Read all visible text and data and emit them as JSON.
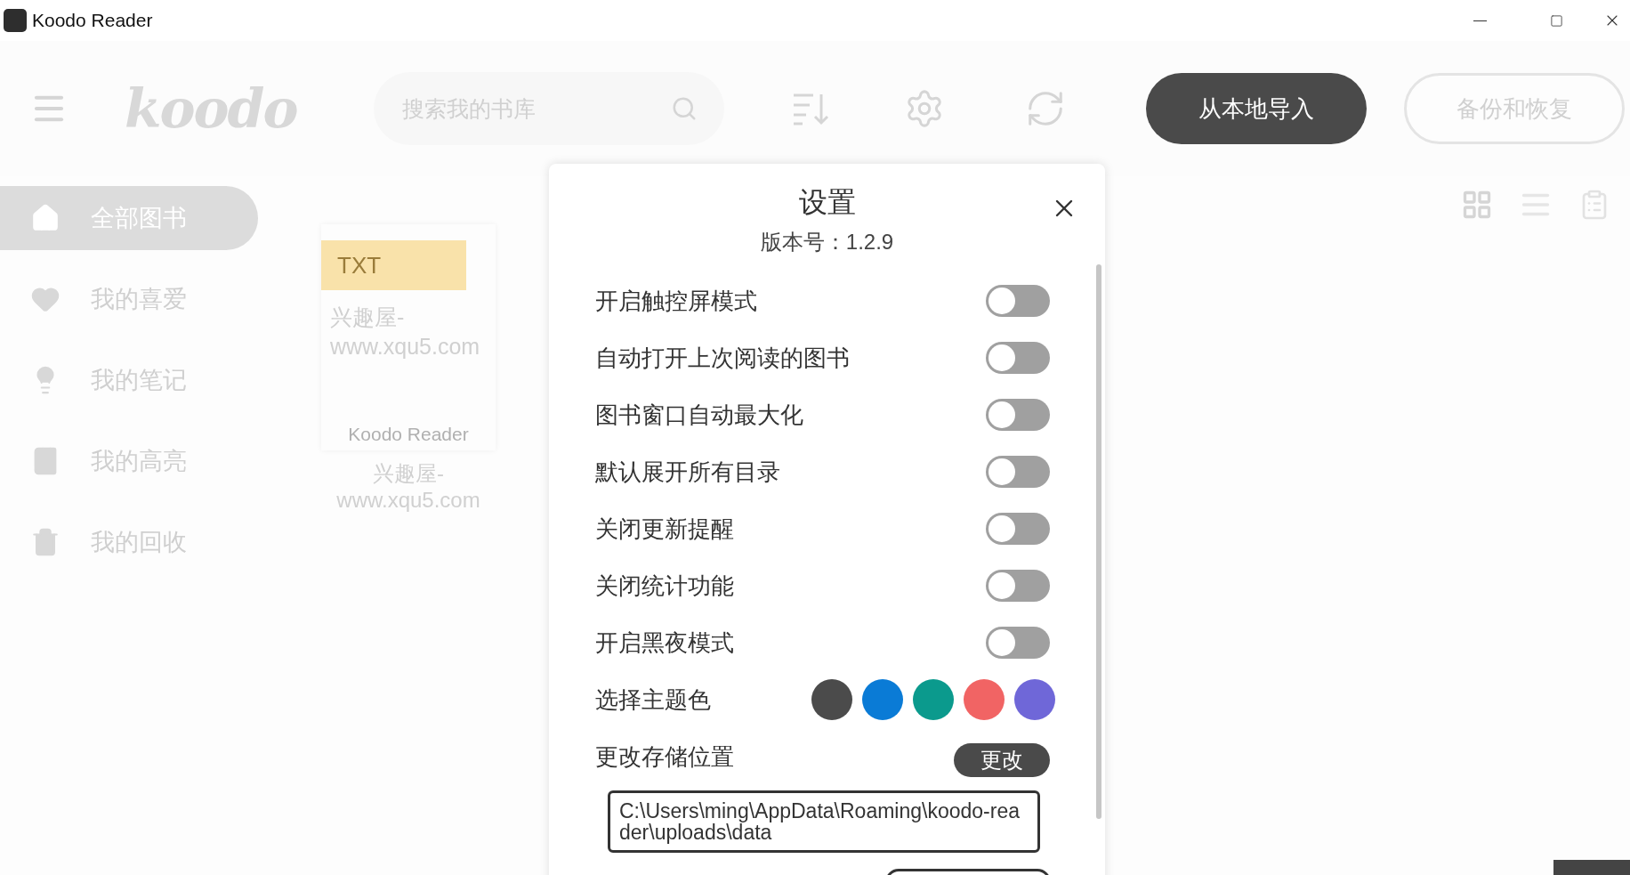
{
  "window": {
    "title": "Koodo Reader"
  },
  "header": {
    "logo": "koodo",
    "search": {
      "placeholder": "搜索我的书库"
    },
    "import_button": "从本地导入",
    "backup_button": "备份和恢复"
  },
  "sidebar": {
    "items": [
      {
        "label": "全部图书",
        "selected": true
      },
      {
        "label": "我的喜爱",
        "selected": false
      },
      {
        "label": "我的笔记",
        "selected": false
      },
      {
        "label": "我的高亮",
        "selected": false
      },
      {
        "label": "我的回收",
        "selected": false
      }
    ]
  },
  "books": [
    {
      "format": "TXT",
      "cover_title": "兴趣屋-www.xqu5.com",
      "cover_footer": "Koodo Reader",
      "title": "兴趣屋-www.xqu5.com"
    }
  ],
  "settings": {
    "title": "设置",
    "version": "版本号：1.2.9",
    "toggles": [
      {
        "label": "开启触控屏模式",
        "on": false
      },
      {
        "label": "自动打开上次阅读的图书",
        "on": false
      },
      {
        "label": "图书窗口自动最大化",
        "on": false
      },
      {
        "label": "默认展开所有目录",
        "on": false
      },
      {
        "label": "关闭更新提醒",
        "on": false
      },
      {
        "label": "关闭统计功能",
        "on": false
      },
      {
        "label": "开启黑夜模式",
        "on": false
      }
    ],
    "theme": {
      "label": "选择主题色",
      "colors": [
        {
          "color": "#4b4b4b"
        },
        {
          "color": "#0a7bd6"
        },
        {
          "color": "#0b9a8d"
        },
        {
          "color": "#f16464"
        },
        {
          "color": "#6f67d8"
        }
      ]
    },
    "storage": {
      "label": "更改存储位置",
      "button": "更改",
      "path": "C:\\Users\\ming\\AppData\\Roaming\\koodo-reader\\uploads\\data"
    }
  }
}
